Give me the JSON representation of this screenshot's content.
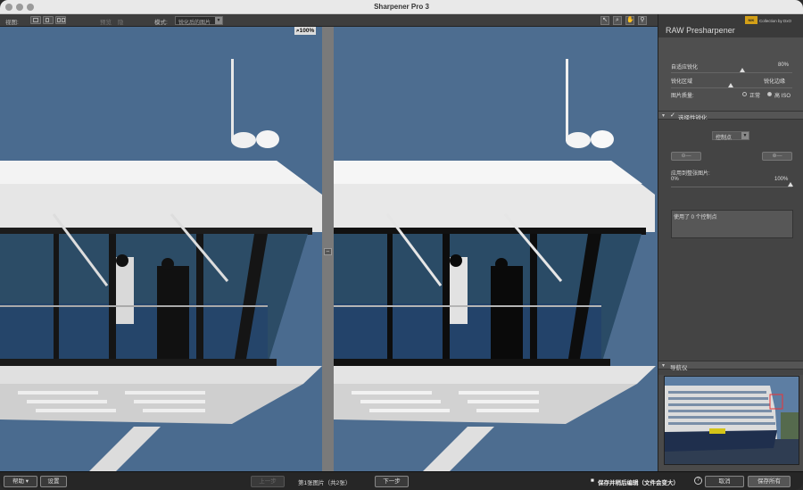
{
  "window": {
    "title": "Sharpener Pro 3"
  },
  "toolbar": {
    "view_label": "视图:",
    "dim_labels": [
      "预览",
      "隐"
    ],
    "mode_label": "模式:",
    "mode_value": "锐化后的图片"
  },
  "viewer": {
    "zoom": "100%"
  },
  "panel": {
    "title": "RAW Presharpener",
    "brand": "Collection by DxO",
    "brand_badge": "NIK",
    "adaptive_label": "自适应锐化",
    "adaptive_value": "80%",
    "sharpen_area_label": "锐化区域",
    "sharpen_edges_label": "锐化边缘",
    "quality_label": "图片质量:",
    "quality_normal": "正常",
    "quality_high_iso": "高 ISO",
    "selective_section": "选择性锐化",
    "control_point_select": "控制点",
    "apply_whole_label": "应用到整张图片:",
    "apply_min": "0%",
    "apply_max": "100%",
    "used_points": "使用了 0 个控制点",
    "reset_btn": "重设",
    "delete_btn": "删除",
    "navigator_section": "导航仪"
  },
  "bottom": {
    "help": "帮助 ▾",
    "settings": "设置",
    "prev": "上一步",
    "image_counter": "第1张图片（共2张）",
    "next": "下一步",
    "save_edit": "保存并稍后编辑（文件会变大）",
    "cancel": "取消",
    "save_all": "保存所有"
  },
  "colors": {
    "sky": "#4a6b8f",
    "panel": "#4a4a4a",
    "brand": "#d4a017"
  }
}
